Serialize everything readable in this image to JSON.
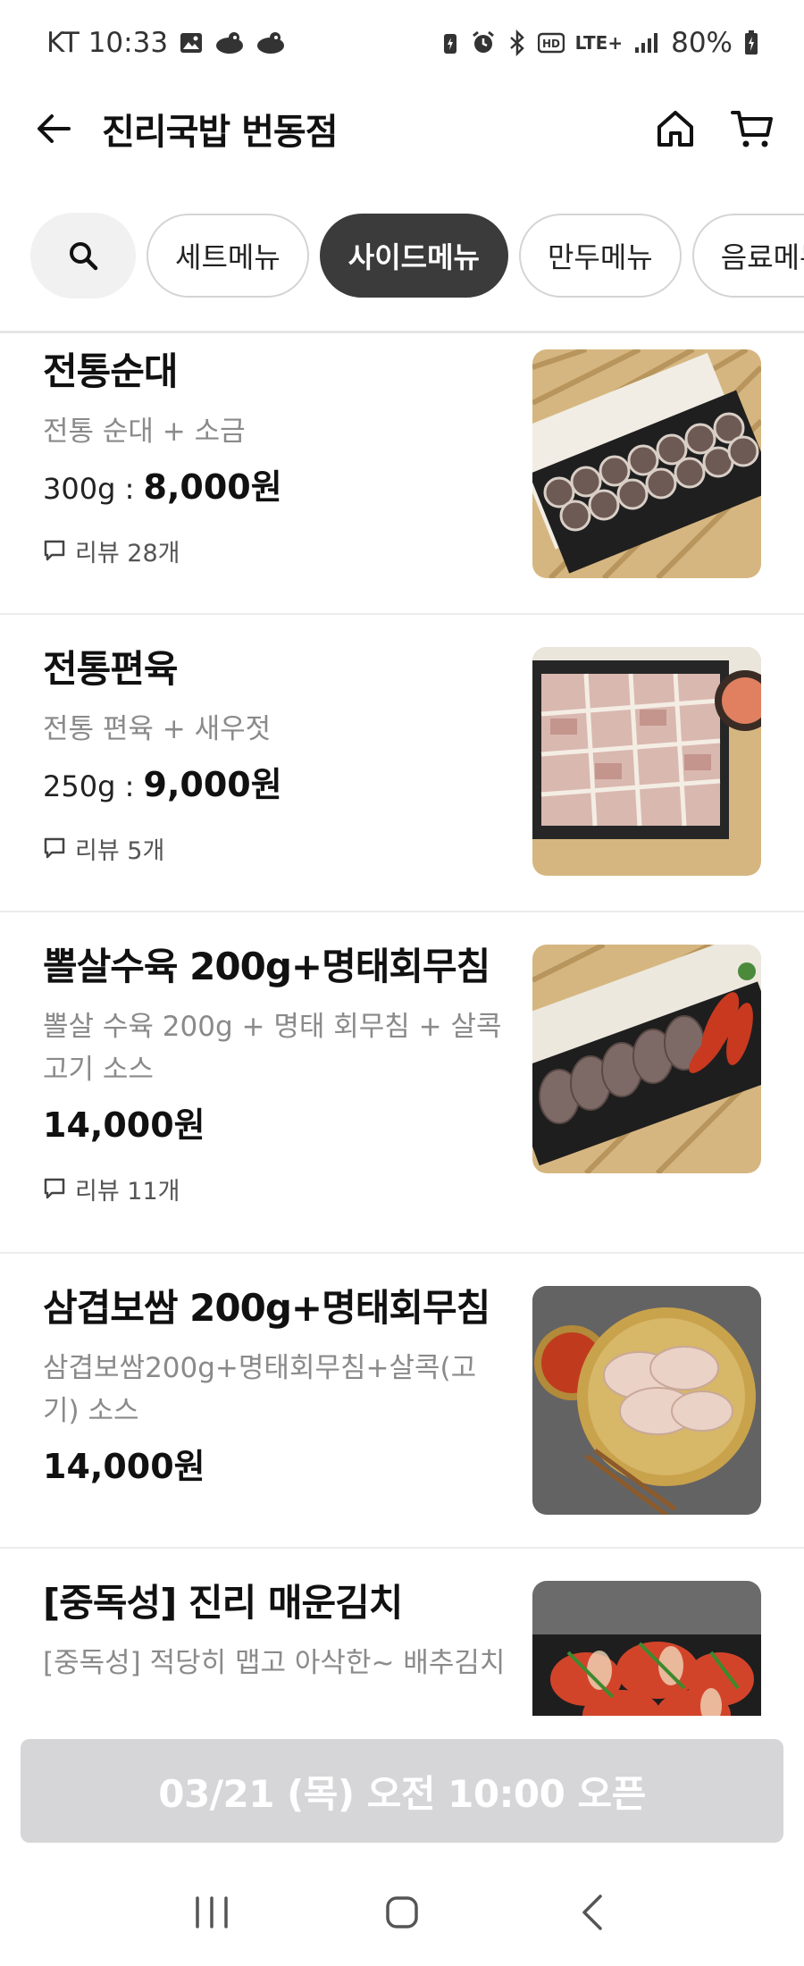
{
  "status_bar": {
    "carrier_time": "KT 10:33",
    "network": "LTE+",
    "battery": "80%"
  },
  "header": {
    "title": "진리국밥 번동점"
  },
  "tabs": [
    {
      "label": "세트메뉴",
      "active": false
    },
    {
      "label": "사이드메뉴",
      "active": true
    },
    {
      "label": "만두메뉴",
      "active": false
    },
    {
      "label": "음료메뉴",
      "active": false
    }
  ],
  "menu_items": [
    {
      "name": "전통순대",
      "description": "전통 순대 + 소금",
      "weight": "300g",
      "separator": " : ",
      "price": "8,000원",
      "review": "리뷰 28개",
      "image": "soondae-photo"
    },
    {
      "name": "전통편육",
      "description": "전통 편육 + 새우젓",
      "weight": "250g",
      "separator": " : ",
      "price": "9,000원",
      "review": "리뷰 5개",
      "image": "pyeonyuk-photo"
    },
    {
      "name": "뽈살수육 200g+명태회무침",
      "description": "뽈살 수육 200g + 명태 회무침 + 살콕 고기 소스",
      "price": "14,000원",
      "review": "리뷰 11개",
      "image": "ppolsal-suyuk-photo"
    },
    {
      "name": "삼겹보쌈 200g+명태회무침",
      "description": "삼겹보쌈200g+명태회무침+살콕(고기) 소스",
      "price": "14,000원",
      "image": "bossam-photo"
    },
    {
      "name": "[중독성] 진리 매운김치",
      "description": "[중독성] 적당히 맵고 아삭한~ 배추김치",
      "image": "kimchi-photo"
    }
  ],
  "order_button": {
    "label": "03/21 (목) 오전 10:00 오픈"
  },
  "colors": {
    "active_tab_bg": "#3b3b3b",
    "disabled_button_bg": "#d6d6d8",
    "desc_text": "#8a8a8a"
  }
}
